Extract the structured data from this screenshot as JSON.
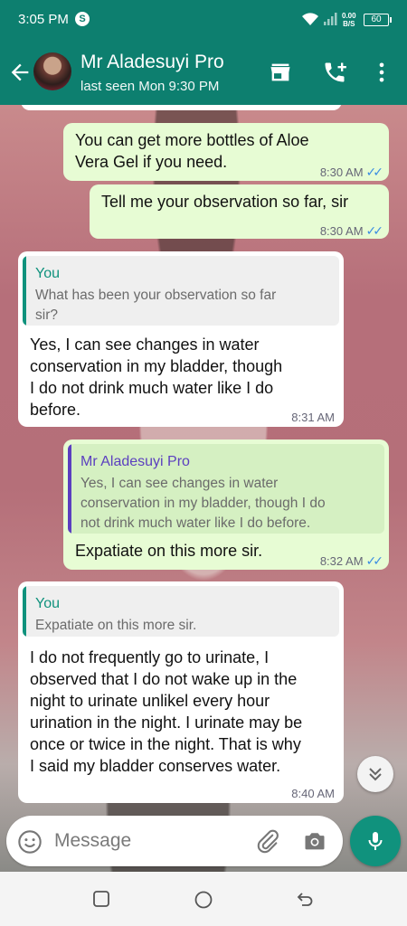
{
  "status_bar": {
    "time": "3:05 PM",
    "app_icon": "S",
    "net_speed_value": "0.00",
    "net_speed_unit": "B/S",
    "battery": "60"
  },
  "header": {
    "contact_name": "Mr Aladesuyi Pro",
    "last_seen": "last seen Mon 9:30 PM",
    "icons": [
      "back-arrow-icon",
      "avatar",
      "store-icon",
      "add-call-icon",
      "more-vert-icon"
    ]
  },
  "messages": [
    {
      "direction": "out",
      "text": "You can get more bottles of Aloe Vera Gel if you need.",
      "lines": [
        "You can get more bottles of Aloe",
        "Vera Gel if you need."
      ],
      "time": "8:30 AM",
      "read": true
    },
    {
      "direction": "out",
      "text": "Tell me your observation so far, sir",
      "time": "8:30 AM",
      "read": true
    },
    {
      "direction": "in",
      "quote": {
        "author": "You",
        "lines": [
          "What has been your observation so far",
          "sir?"
        ]
      },
      "lines": [
        "Yes, I can see changes in water",
        "conservation in my bladder, though",
        "I do not drink much water like I do",
        "before."
      ],
      "time": "8:31 AM"
    },
    {
      "direction": "out",
      "quote": {
        "author": "Mr Aladesuyi Pro",
        "lines": [
          "Yes, I can see changes in water",
          "conservation in my bladder, though I do",
          "not drink much water like I do before."
        ]
      },
      "text": "Expatiate on this more sir.",
      "time": "8:32 AM",
      "read": true
    },
    {
      "direction": "in",
      "quote": {
        "author": "You",
        "lines": [
          "Expatiate on this more sir."
        ]
      },
      "lines": [
        "I do not frequently go to urinate,  I",
        "observed that I do not wake up in the",
        "night to urinate unlikel every hour",
        "urination in the night. I urinate may be",
        "once or twice in the night. That is why",
        "I said my bladder conserves water."
      ],
      "time": "8:40 AM"
    }
  ],
  "composer": {
    "placeholder": "Message"
  },
  "colors": {
    "header": "#0d7f6f",
    "outgoing_bubble": "#e7fcd4",
    "incoming_bubble": "#ffffff",
    "quote_you": "#10927d",
    "quote_contact": "#5b3fbf",
    "read_ticks": "#3b8de2",
    "mic_button": "#10927d"
  }
}
